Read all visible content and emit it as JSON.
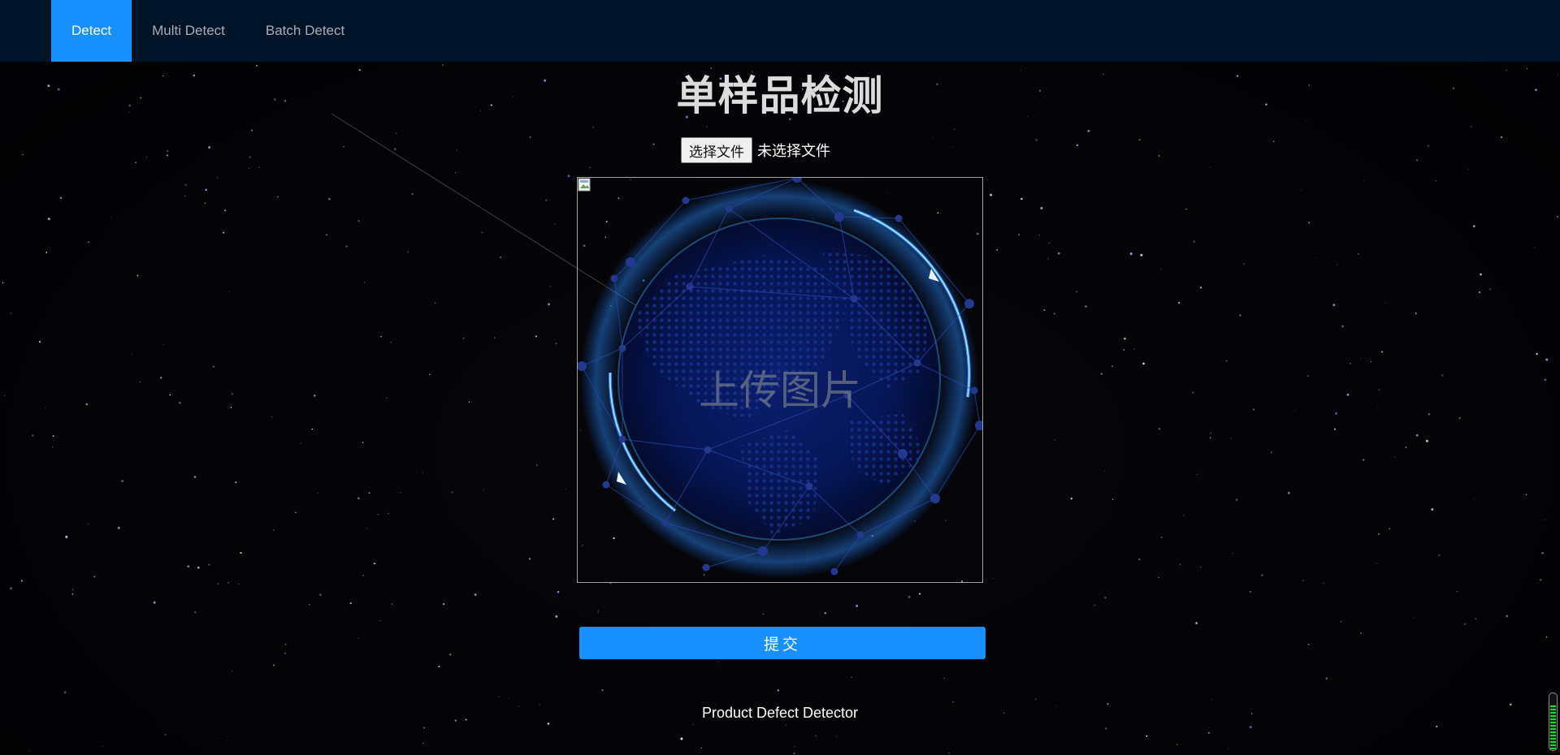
{
  "nav": {
    "tabs": [
      {
        "label": "Detect",
        "active": true
      },
      {
        "label": "Multi Detect",
        "active": false
      },
      {
        "label": "Batch Detect",
        "active": false
      }
    ]
  },
  "page": {
    "title": "单样品检测"
  },
  "file_input": {
    "button_label": "选择文件",
    "status": "未选择文件"
  },
  "upload": {
    "label": "上传图片"
  },
  "actions": {
    "submit_label": "提交"
  },
  "footer": {
    "text": "Product Defect Detector"
  },
  "colors": {
    "accent": "#1890ff",
    "navbar": "#001428",
    "background": "#030305"
  },
  "meter": {
    "level": 0.78
  }
}
